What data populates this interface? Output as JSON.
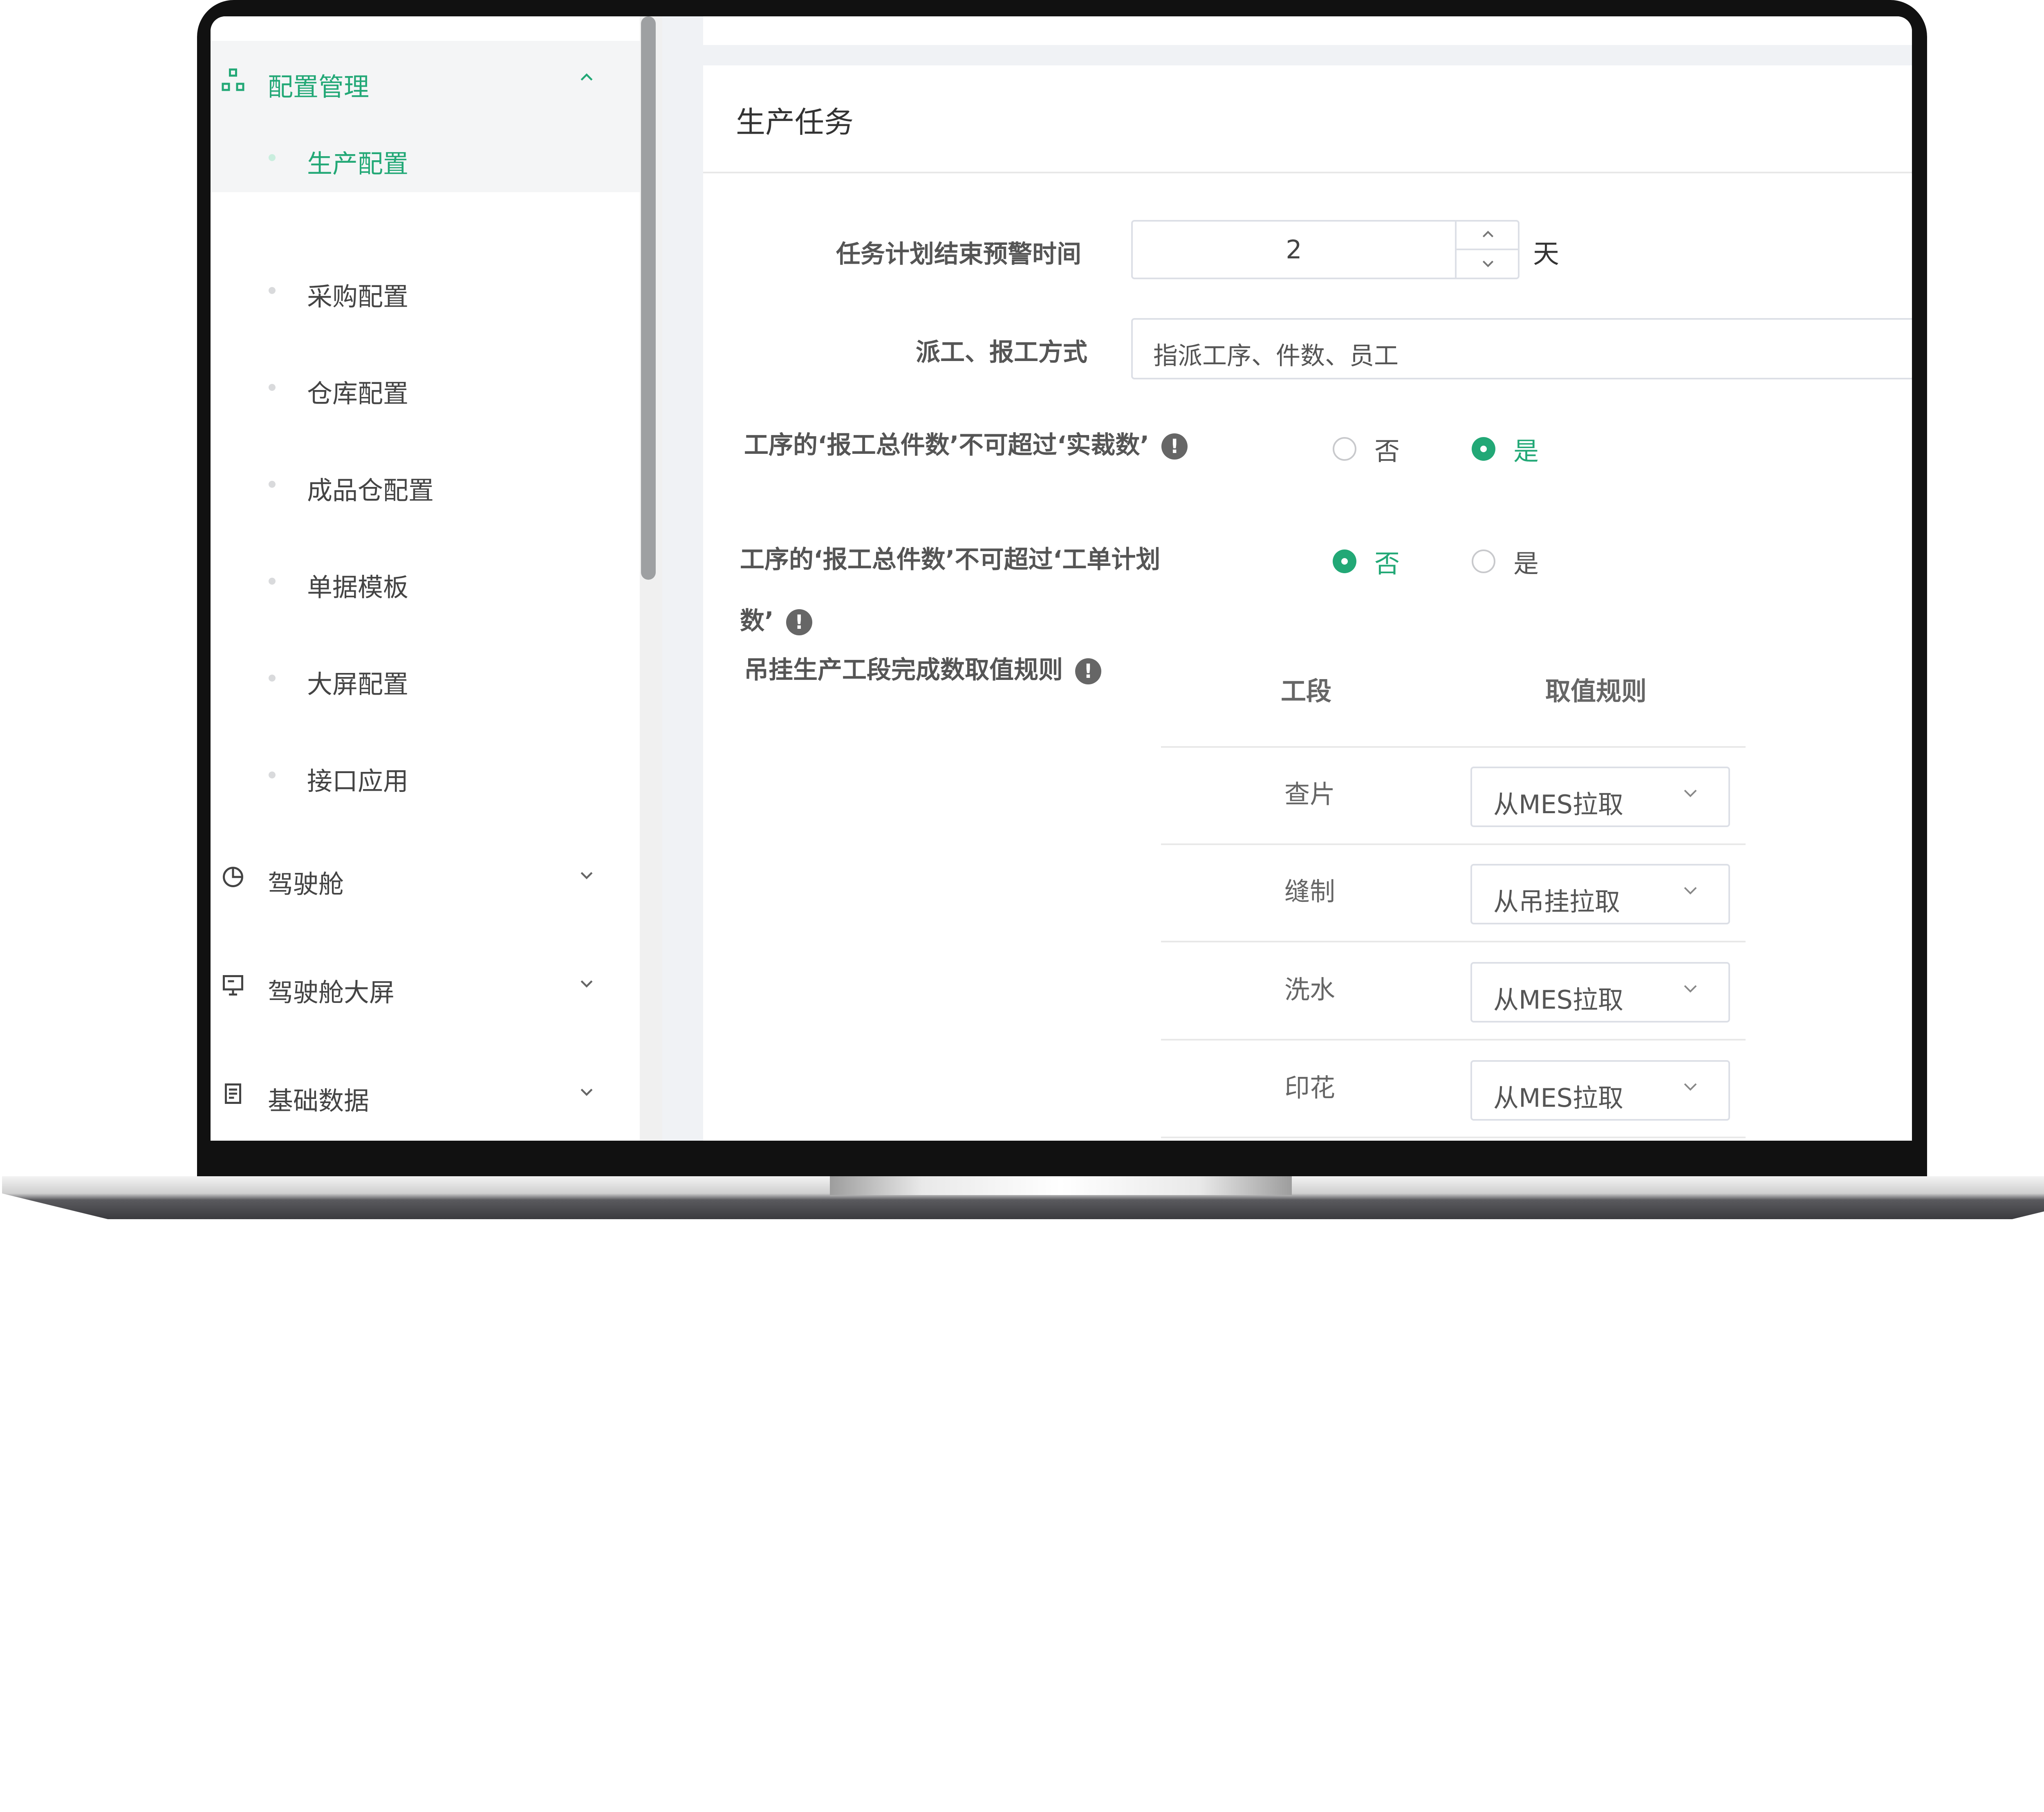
{
  "sidebar": {
    "config_group": {
      "label": "配置管理",
      "icon": "network-icon"
    },
    "sub_items": [
      {
        "label": "生产配置",
        "selected": true
      },
      {
        "label": "采购配置"
      },
      {
        "label": "仓库配置"
      },
      {
        "label": "成品仓配置"
      },
      {
        "label": "单据模板"
      },
      {
        "label": "大屏配置"
      },
      {
        "label": "接口应用"
      }
    ],
    "groups": [
      {
        "label": "驾驶舱",
        "icon": "pie-chart-icon"
      },
      {
        "label": "驾驶舱大屏",
        "icon": "monitor-icon"
      },
      {
        "label": "基础数据",
        "icon": "document-icon"
      }
    ]
  },
  "card": {
    "title": "生产任务",
    "fields": {
      "warning_time": {
        "label": "任务计划结束预警时间",
        "value": "2",
        "unit": "天"
      },
      "dispatch_mode": {
        "label": "派工、报工方式",
        "value": "指派工序、件数、员工"
      },
      "limit_cut": {
        "label": "工序的‘报工总件数’不可超过‘实裁数’",
        "options": [
          "否",
          "是"
        ],
        "selected": "是"
      },
      "limit_plan": {
        "label_line1": "工序的‘报工总件数’不可超过‘工单计划",
        "label_line2": "数’",
        "options": [
          "否",
          "是"
        ],
        "selected": "否"
      },
      "hanging_rule": {
        "label": "吊挂生产工段完成数取值规则"
      }
    },
    "table": {
      "headers": [
        "工段",
        "取值规则"
      ],
      "rows": [
        {
          "stage": "查片",
          "rule": "从MES拉取"
        },
        {
          "stage": "缝制",
          "rule": "从吊挂拉取"
        },
        {
          "stage": "洗水",
          "rule": "从MES拉取"
        },
        {
          "stage": "印花",
          "rule": "从MES拉取"
        }
      ]
    }
  },
  "colors": {
    "accent": "#22a876",
    "border": "#dcdfe6",
    "menu_bg": "#f4f5f6"
  }
}
